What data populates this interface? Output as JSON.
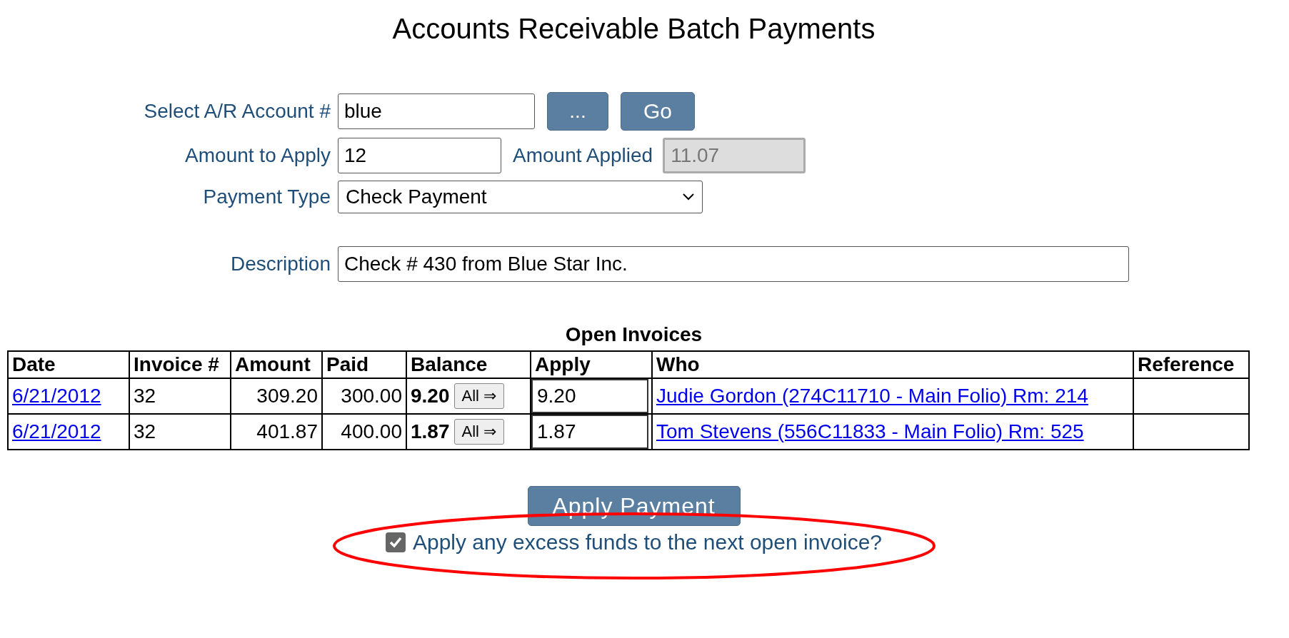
{
  "title": "Accounts Receivable Batch Payments",
  "form": {
    "account": {
      "label": "Select A/R Account #",
      "value": "blue"
    },
    "browse_button": "...",
    "go_button": "Go",
    "amount_to_apply": {
      "label": "Amount to Apply",
      "value": "12"
    },
    "amount_applied": {
      "label": "Amount Applied",
      "value": "11.07",
      "disabled": true
    },
    "payment_type": {
      "label": "Payment Type",
      "value": "Check Payment"
    },
    "description": {
      "label": "Description",
      "value": "Check # 430 from Blue Star Inc."
    }
  },
  "invoices": {
    "title": "Open Invoices",
    "columns": [
      "Date",
      "Invoice #",
      "Amount",
      "Paid",
      "Balance",
      "Apply",
      "Who",
      "Reference"
    ],
    "rows": [
      {
        "date": "6/21/2012",
        "invoice": "32",
        "amount": "309.20",
        "paid": "300.00",
        "balance": "9.20",
        "all_button": "All ⇒",
        "apply": "9.20",
        "who": "Judie Gordon (274C11710 - Main Folio) Rm: 214"
      },
      {
        "date": "6/21/2012",
        "invoice": "32",
        "amount": "401.87",
        "paid": "400.00",
        "balance": "1.87",
        "all_button": "All ⇒",
        "apply": "1.87",
        "who": "Tom Stevens (556C11833 - Main Folio) Rm: 525"
      }
    ]
  },
  "apply_button": "Apply Payment",
  "excess_funds": {
    "label": "Apply any excess funds to the next open invoice?",
    "checked": true
  },
  "annotation": {
    "kind": "ellipse"
  }
}
